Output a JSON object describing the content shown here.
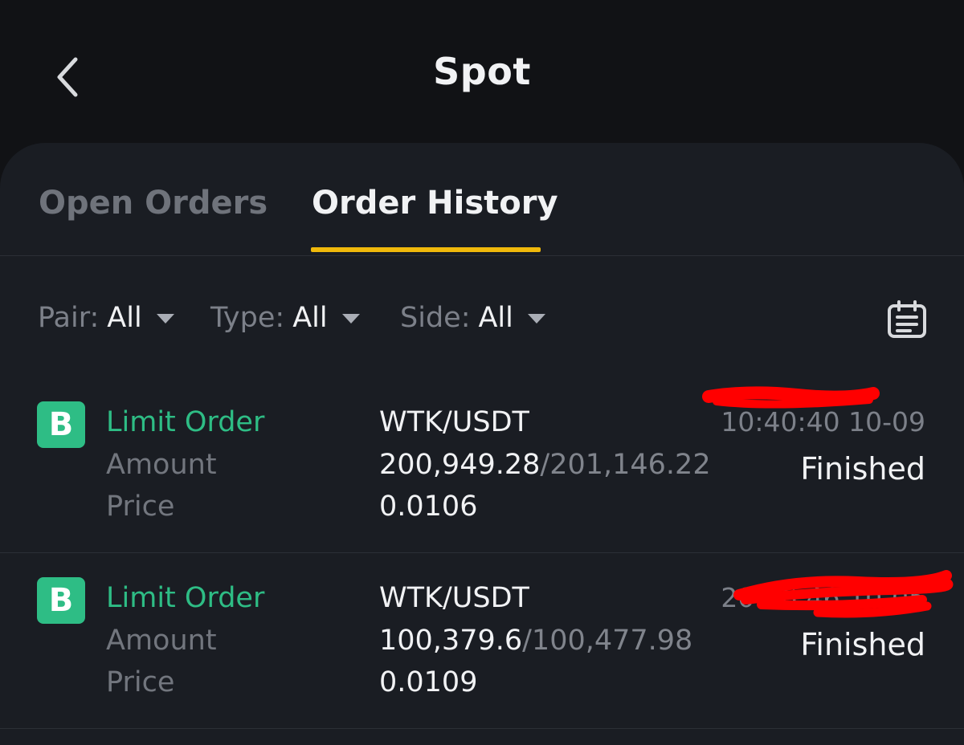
{
  "header": {
    "title": "Spot"
  },
  "tabs": [
    {
      "label": "Open Orders"
    },
    {
      "label": "Order History"
    }
  ],
  "filters": {
    "pair": {
      "label": "Pair:",
      "value": "All"
    },
    "type": {
      "label": "Type:",
      "value": "All"
    },
    "side": {
      "label": "Side:",
      "value": "All"
    }
  },
  "orders": [
    {
      "side_badge": "B",
      "order_type": "Limit Order",
      "amount_label": "Amount",
      "price_label": "Price",
      "pair": "WTK/USDT",
      "amount_filled": "200,949.28",
      "amount_total": "/201,146.22",
      "price": "0.0106",
      "time": "10:40:40 10-09",
      "status": "Finished"
    },
    {
      "side_badge": "B",
      "order_type": "Limit Order",
      "amount_label": "Amount",
      "price_label": "Price",
      "pair": "WTK/USDT",
      "amount_filled": "100,379.6",
      "amount_total": "/100,477.98",
      "price": "0.0109",
      "time": "20:46:46 10-05",
      "status": "Finished"
    }
  ],
  "colors": {
    "background": "#111215",
    "panel": "#1a1d23",
    "accent": "#f0b90b",
    "buy": "#2ebd85",
    "redaction": "#ff0000"
  },
  "icons": {
    "back": "chevron-left-icon",
    "calendar": "calendar-icon"
  }
}
